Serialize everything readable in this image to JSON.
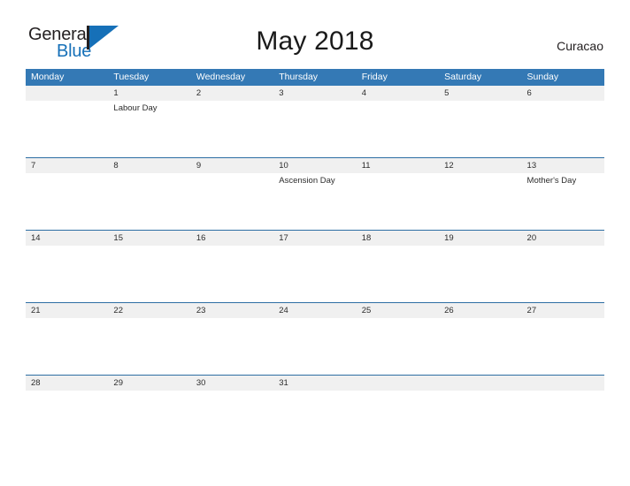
{
  "brand": {
    "name_top": "General",
    "name_bottom": "Blue",
    "flag_icon": "blue-flag-triangle-icon"
  },
  "header": {
    "title": "May 2018",
    "locale": "Curacao"
  },
  "colors": {
    "header_blue": "#3479b5",
    "row_divider_blue": "#2d6ea3",
    "date_band_gray": "#f0f0f0",
    "brand_blue": "#1670b8",
    "text_dark": "#2c2c2c"
  },
  "calendar": {
    "weekdays": [
      "Monday",
      "Tuesday",
      "Wednesday",
      "Thursday",
      "Friday",
      "Saturday",
      "Sunday"
    ],
    "weeks": [
      {
        "days": [
          {
            "num": "",
            "events": []
          },
          {
            "num": "1",
            "events": [
              "Labour Day"
            ]
          },
          {
            "num": "2",
            "events": []
          },
          {
            "num": "3",
            "events": []
          },
          {
            "num": "4",
            "events": []
          },
          {
            "num": "5",
            "events": []
          },
          {
            "num": "6",
            "events": []
          }
        ]
      },
      {
        "days": [
          {
            "num": "7",
            "events": []
          },
          {
            "num": "8",
            "events": []
          },
          {
            "num": "9",
            "events": []
          },
          {
            "num": "10",
            "events": [
              "Ascension Day"
            ]
          },
          {
            "num": "11",
            "events": []
          },
          {
            "num": "12",
            "events": []
          },
          {
            "num": "13",
            "events": [
              "Mother's Day"
            ]
          }
        ]
      },
      {
        "days": [
          {
            "num": "14",
            "events": []
          },
          {
            "num": "15",
            "events": []
          },
          {
            "num": "16",
            "events": []
          },
          {
            "num": "17",
            "events": []
          },
          {
            "num": "18",
            "events": []
          },
          {
            "num": "19",
            "events": []
          },
          {
            "num": "20",
            "events": []
          }
        ]
      },
      {
        "days": [
          {
            "num": "21",
            "events": []
          },
          {
            "num": "22",
            "events": []
          },
          {
            "num": "23",
            "events": []
          },
          {
            "num": "24",
            "events": []
          },
          {
            "num": "25",
            "events": []
          },
          {
            "num": "26",
            "events": []
          },
          {
            "num": "27",
            "events": []
          }
        ]
      },
      {
        "days": [
          {
            "num": "28",
            "events": []
          },
          {
            "num": "29",
            "events": []
          },
          {
            "num": "30",
            "events": []
          },
          {
            "num": "31",
            "events": []
          },
          {
            "num": "",
            "events": []
          },
          {
            "num": "",
            "events": []
          },
          {
            "num": "",
            "events": []
          }
        ]
      }
    ]
  }
}
